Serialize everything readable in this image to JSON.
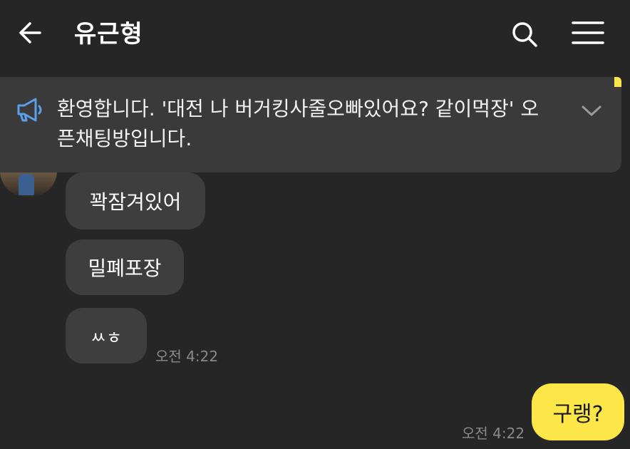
{
  "header": {
    "title": "유근형",
    "icons": [
      "back-arrow-icon",
      "search-icon",
      "menu-icon"
    ]
  },
  "notice": {
    "icon": "megaphone-icon",
    "text": "환영합니다. '대전 나 버거킹사줄오빠있어요? 같이먹장' 오픈채팅방입니다.",
    "expand_icon": "chevron-down-icon"
  },
  "messages": [
    {
      "text": "꽉잠겨있어"
    },
    {
      "text": "밀폐포장"
    },
    {
      "text": "ㅆㅎ",
      "time": "오전 4:22"
    }
  ],
  "my_message": {
    "text": "구랭?",
    "time": "오전 4:22"
  },
  "colors": {
    "background": "#262626",
    "notice_bg": "#3a3a3a",
    "bubble_other": "#3e3e3e",
    "bubble_me": "#fde648",
    "timestamp": "#8a8a8a"
  }
}
